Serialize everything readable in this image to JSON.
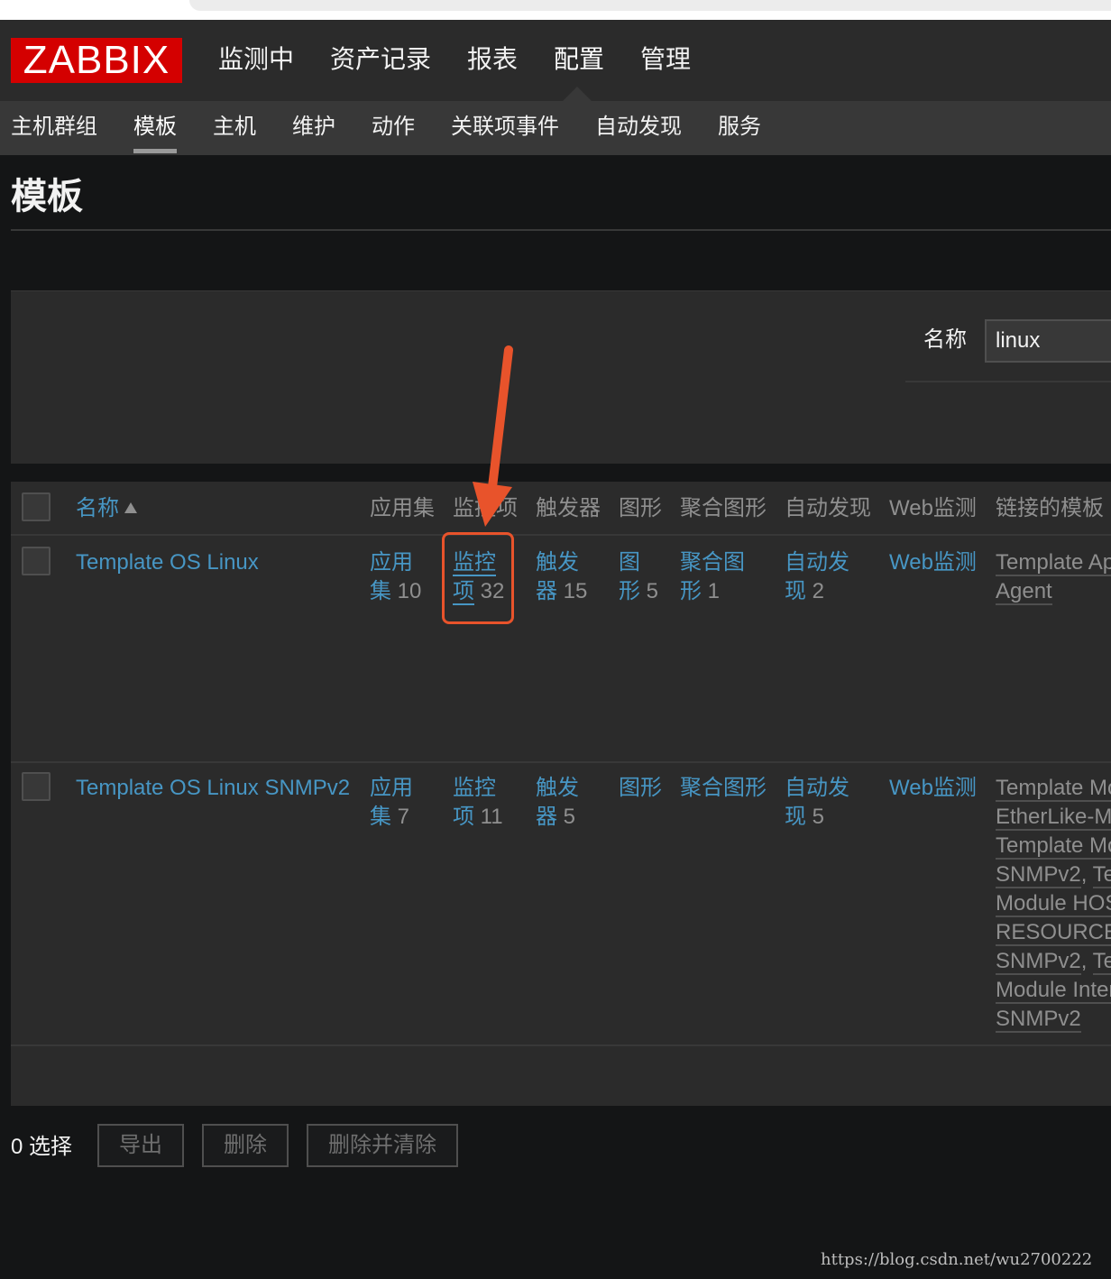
{
  "logo": "ZABBIX",
  "main_menu": [
    "监测中",
    "资产记录",
    "报表",
    "配置",
    "管理"
  ],
  "sub_menu": [
    "主机群组",
    "模板",
    "主机",
    "维护",
    "动作",
    "关联项事件",
    "自动发现",
    "服务"
  ],
  "page_title": "模板",
  "filter": {
    "label": "名称",
    "value": "linux"
  },
  "table": {
    "headers": [
      "名称",
      "应用集",
      "监控项",
      "触发器",
      "图形",
      "聚合图形",
      "自动发现",
      "Web监测",
      "链接的模板"
    ],
    "rows": [
      {
        "name": "Template OS Linux",
        "apps": [
          "应用",
          "集",
          "10"
        ],
        "items": [
          "监控",
          "项",
          "32"
        ],
        "triggers": [
          "触发",
          "器",
          "15"
        ],
        "graphs": [
          "图",
          "形",
          "5"
        ],
        "screens": [
          "聚合图",
          "形",
          "1"
        ],
        "discovery": [
          "自动发",
          "现",
          "2"
        ],
        "web": "Web监测",
        "linked": [
          "Template Ap",
          "Agent"
        ]
      },
      {
        "name": "Template OS Linux SNMPv2",
        "apps": [
          "应用",
          "集",
          "7"
        ],
        "items": [
          "监控",
          "项",
          "11"
        ],
        "triggers": [
          "触发",
          "器",
          "5"
        ],
        "graphs": "图形",
        "screens": "聚合图形",
        "discovery": [
          "自动发",
          "现",
          "5"
        ],
        "web": "Web监测",
        "linked": [
          "Template Mo",
          "EtherLike-M",
          "Template Mo",
          "SNMPv2",
          "Te",
          "Module HOS",
          "RESOURCE",
          "SNMPv2",
          "Te",
          "Module Inter",
          "SNMPv2"
        ]
      }
    ]
  },
  "footer": {
    "selected": "0 选择",
    "buttons": [
      "导出",
      "删除",
      "删除并清除"
    ]
  },
  "watermark": "https://blog.csdn.net/wu2700222",
  "colors": {
    "accent": "#4796c4",
    "logo": "#d40000",
    "annotation": "#e8532b"
  }
}
